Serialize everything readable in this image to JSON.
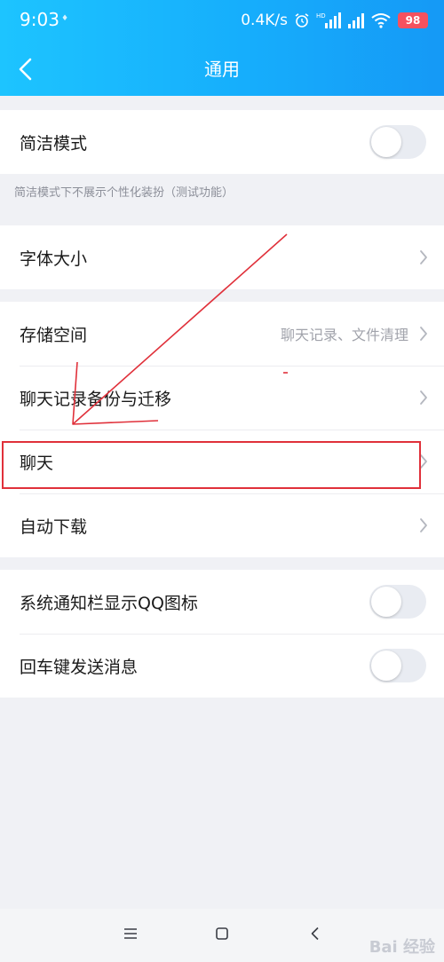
{
  "status_bar": {
    "time": "9:03",
    "dot": "♦",
    "net_speed": "0.4K/s",
    "hd_label": "HD",
    "battery": "98"
  },
  "header": {
    "title": "通用",
    "color_start": "#1dc4ff",
    "color_end": "#1599f6"
  },
  "simple_mode": {
    "label": "简洁模式",
    "enabled": false,
    "hint": "简洁模式下不展示个性化装扮（测试功能）"
  },
  "font_size": {
    "label": "字体大小"
  },
  "storage": {
    "items": [
      {
        "label": "存储空间",
        "value": "聊天记录、文件清理"
      },
      {
        "label": "聊天记录备份与迁移"
      },
      {
        "label": "聊天"
      },
      {
        "label": "自动下载"
      }
    ]
  },
  "toggles": {
    "items": [
      {
        "label": "系统通知栏显示QQ图标",
        "enabled": false
      },
      {
        "label": "回车键发送消息",
        "enabled": false
      }
    ]
  },
  "annotation_color": "#e0303a",
  "watermark": "Bai 经验"
}
